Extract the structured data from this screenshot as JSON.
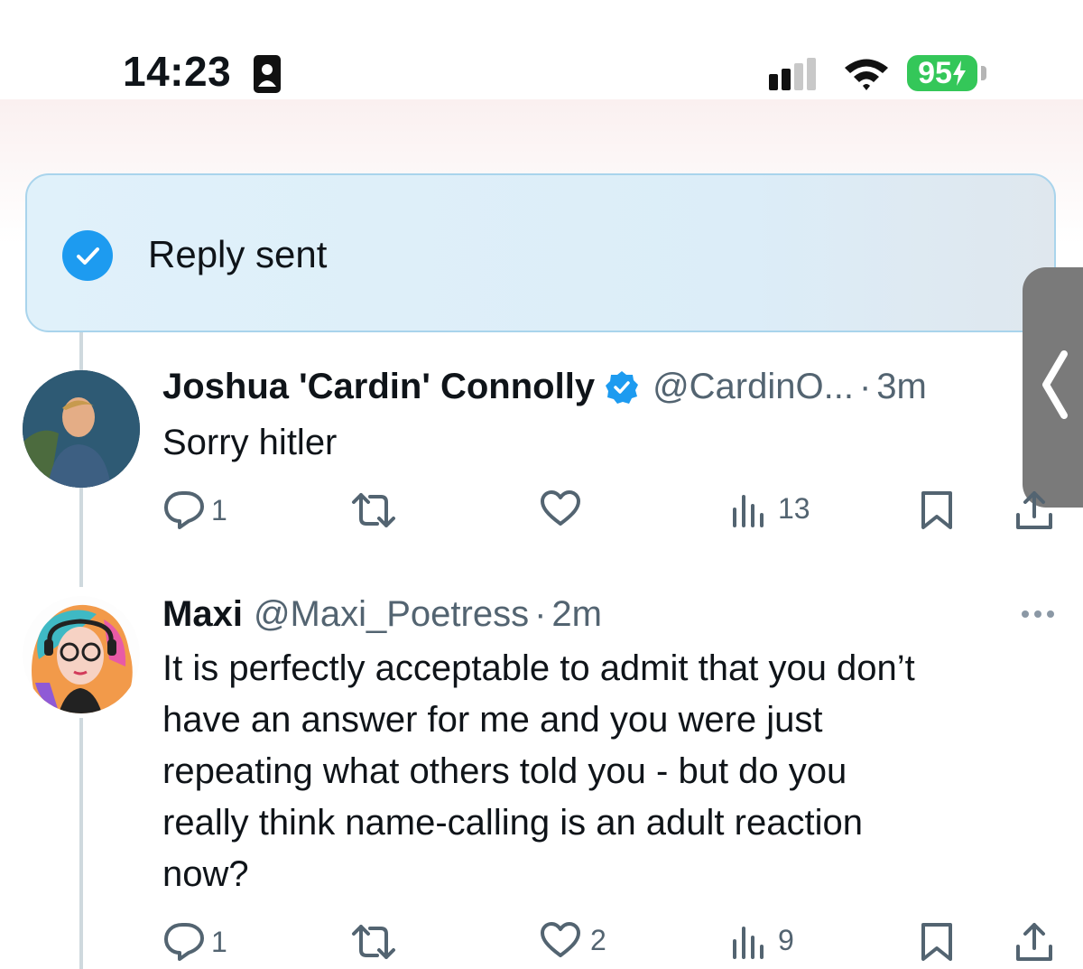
{
  "status_bar": {
    "time": "14:23",
    "battery": "95"
  },
  "toast": {
    "text": "Reply sent"
  },
  "tweets": [
    {
      "name": "Joshua 'Cardin' Connolly",
      "handle": "@CardinO...",
      "separator": "·",
      "time": "3m",
      "text": "Sorry hitler",
      "verified": true,
      "stats": {
        "replies": "1",
        "reposts": "",
        "likes": "",
        "views": "13"
      }
    },
    {
      "name": "Maxi",
      "handle": "@Maxi_Poetress",
      "separator": "·",
      "time": "2m",
      "text_lines": [
        "It is perfectly acceptable to admit that you don’t",
        "have an answer for me and you were just",
        "repeating what others told you - but do you",
        "really think name-calling is an adult reaction",
        "now?"
      ],
      "verified": false,
      "stats": {
        "replies": "1",
        "reposts": "",
        "likes": "2",
        "views": "9"
      }
    }
  ],
  "colors": {
    "accent": "#1d9bf0",
    "toast_bg": "#e0f1fa",
    "toast_border": "#a9d4ec",
    "battery": "#34c759",
    "secondary_text": "#536471"
  },
  "icons": [
    "id-card-icon",
    "cellular-signal-icon",
    "wifi-icon",
    "checkmark-circle-icon",
    "chevron-left-icon",
    "verified-badge-icon",
    "reply-icon",
    "repost-icon",
    "like-icon",
    "views-icon",
    "bookmark-icon",
    "share-icon",
    "more-icon"
  ]
}
